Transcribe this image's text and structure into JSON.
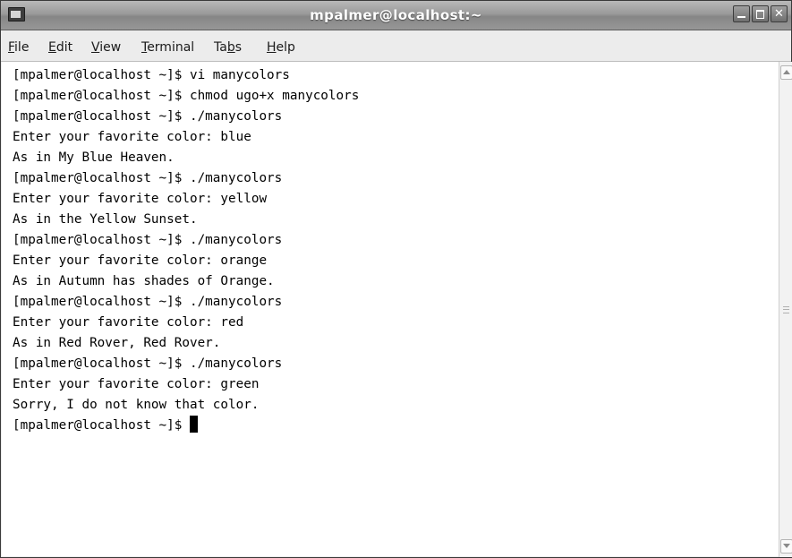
{
  "window": {
    "title": "mpalmer@localhost:~"
  },
  "menu": [
    {
      "label": "File",
      "mnemonic": "F",
      "rest": "ile"
    },
    {
      "label": "Edit",
      "mnemonic": "E",
      "rest": "dit"
    },
    {
      "label": "View",
      "mnemonic": "V",
      "rest": "iew"
    },
    {
      "label": "Terminal",
      "mnemonic": "T",
      "rest": "erminal"
    },
    {
      "label": "Tabs",
      "pre": "Ta",
      "mnemonic": "b",
      "rest": "s"
    },
    {
      "label": "Help",
      "mnemonic": "H",
      "rest": "elp"
    }
  ],
  "terminal": {
    "lines": [
      "[mpalmer@localhost ~]$ vi manycolors",
      "[mpalmer@localhost ~]$ chmod ugo+x manycolors",
      "[mpalmer@localhost ~]$ ./manycolors",
      "Enter your favorite color: blue",
      "As in My Blue Heaven.",
      "[mpalmer@localhost ~]$ ./manycolors",
      "Enter your favorite color: yellow",
      "As in the Yellow Sunset.",
      "[mpalmer@localhost ~]$ ./manycolors",
      "Enter your favorite color: orange",
      "As in Autumn has shades of Orange.",
      "[mpalmer@localhost ~]$ ./manycolors",
      "Enter your favorite color: red",
      "As in Red Rover, Red Rover.",
      "[mpalmer@localhost ~]$ ./manycolors",
      "Enter your favorite color: green",
      "Sorry, I do not know that color."
    ],
    "prompt": "[mpalmer@localhost ~]$ "
  },
  "colors": {
    "background": "#ffffff",
    "foreground": "#000000"
  },
  "icons": {
    "window_icon": "terminal-icon",
    "minimize": "minimize-icon",
    "maximize": "maximize-icon",
    "close": "close-icon",
    "scroll_up": "scroll-up-arrow-icon",
    "scroll_down": "scroll-down-arrow-icon"
  }
}
